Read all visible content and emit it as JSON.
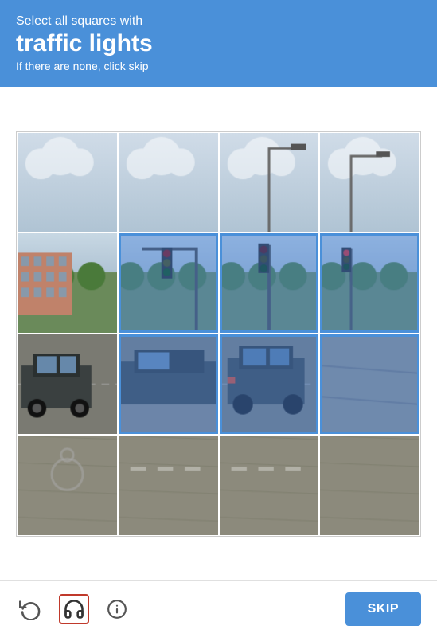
{
  "header": {
    "select_prefix": "Select all squares with",
    "subject": "traffic lights",
    "hint": "If there are none, click skip"
  },
  "footer": {
    "skip_label": "SKIP",
    "refresh_title": "Get a new challenge",
    "headphone_title": "Get an audio challenge",
    "info_title": "Help"
  },
  "grid": {
    "rows": 4,
    "cols": 4,
    "selected_cells": [
      5,
      6,
      7,
      9,
      10,
      11
    ]
  }
}
